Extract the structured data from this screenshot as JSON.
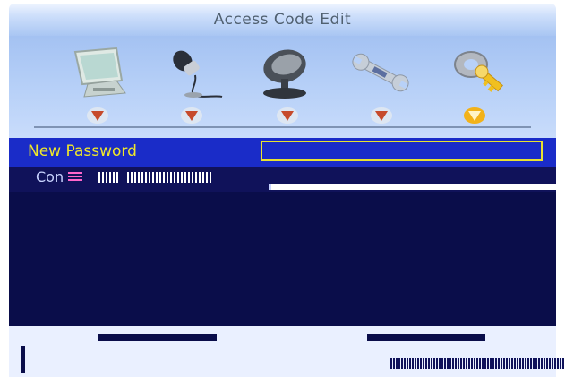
{
  "window": {
    "title": "Access Code Edit"
  },
  "menu": {
    "items": [
      {
        "icon": "monitor-icon",
        "selected": false
      },
      {
        "icon": "microphone-icon",
        "selected": false
      },
      {
        "icon": "satellite-dish-icon",
        "selected": false
      },
      {
        "icon": "wrench-icon",
        "selected": false
      },
      {
        "icon": "key-icon",
        "selected": true
      }
    ]
  },
  "form": {
    "new_password_label": "New Password",
    "confirm_label_prefix": "Con"
  },
  "colors": {
    "title_gradient": "#a9c6f3",
    "row_highlight": "#1a2cc8",
    "label_yellow": "#f0e82a",
    "panel_dark": "#0a0d4a",
    "arrow_selected": "#f2b21a",
    "arrow_normal": "#c64a2b"
  }
}
